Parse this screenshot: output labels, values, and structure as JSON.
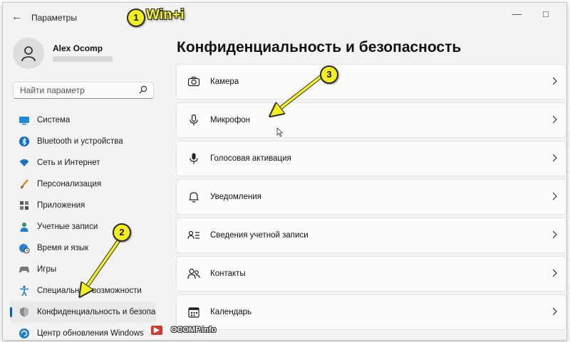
{
  "window": {
    "title": "Параметры",
    "back_glyph": "←",
    "minimize_glyph": "—",
    "maximize_glyph": "□"
  },
  "annotations": {
    "step1_number": "1",
    "hotkey": "Win+i",
    "step2_number": "2",
    "step3_number": "3",
    "arrow_color": "#f4f01c"
  },
  "profile": {
    "name": "Alex Ocomp"
  },
  "search": {
    "placeholder": "Найти параметр"
  },
  "sidebar": {
    "items": [
      {
        "label": "Система",
        "icon": "monitor-icon"
      },
      {
        "label": "Bluetooth и устройства",
        "icon": "bluetooth-icon"
      },
      {
        "label": "Сеть и Интернет",
        "icon": "wifi-icon"
      },
      {
        "label": "Персонализация",
        "icon": "brush-icon"
      },
      {
        "label": "Приложения",
        "icon": "apps-icon"
      },
      {
        "label": "Учетные записи",
        "icon": "person-icon"
      },
      {
        "label": "Время и язык",
        "icon": "globe-clock-icon"
      },
      {
        "label": "Игры",
        "icon": "gamepad-icon"
      },
      {
        "label": "Специальные возможности",
        "icon": "accessibility-icon"
      },
      {
        "label": "Конфиденциальность и безопасность",
        "icon": "shield-icon",
        "active": true
      },
      {
        "label": "Центр обновления Windows",
        "icon": "update-icon"
      }
    ]
  },
  "main": {
    "title": "Конфиденциальность и безопасность",
    "rows": [
      {
        "label": "Камера",
        "icon": "camera-icon"
      },
      {
        "label": "Микрофон",
        "icon": "microphone-icon"
      },
      {
        "label": "Голосовая активация",
        "icon": "voice-microphone-icon"
      },
      {
        "label": "Уведомления",
        "icon": "bell-icon"
      },
      {
        "label": "Сведения учетной записи",
        "icon": "account-info-icon"
      },
      {
        "label": "Контакты",
        "icon": "contacts-icon"
      },
      {
        "label": "Календарь",
        "icon": "calendar-icon"
      }
    ]
  },
  "watermark": {
    "badge": "▶",
    "text": "OCOMP.info"
  },
  "colors": {
    "accent": "#005fb8",
    "window_bg": "#f3f3f3",
    "card_bg": "#fbfbfb"
  }
}
